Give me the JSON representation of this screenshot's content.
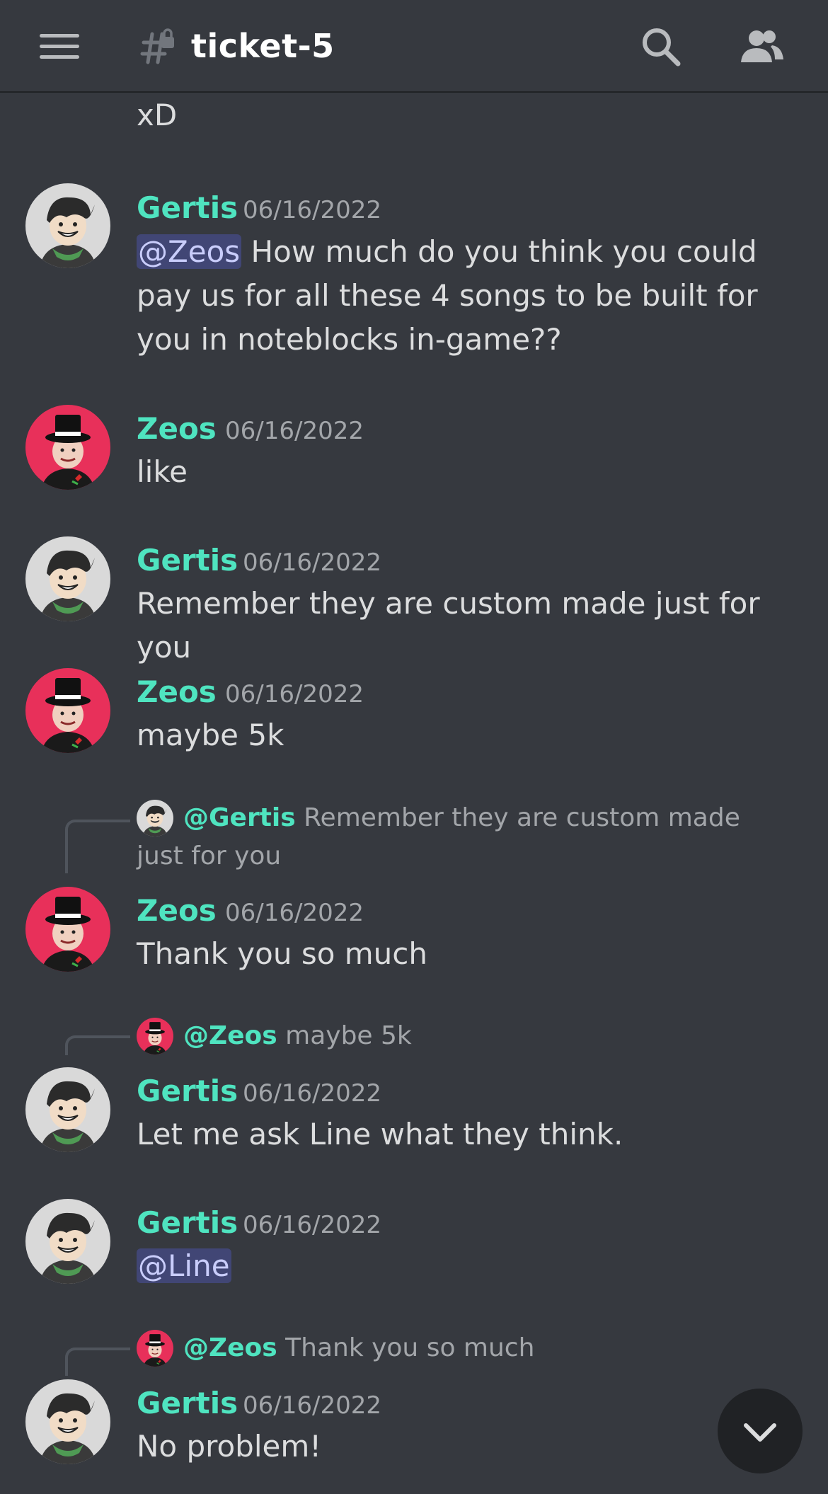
{
  "header": {
    "channel_name": "ticket-5",
    "menu_icon": "hamburger-icon",
    "channel_icon": "locked-hash-icon",
    "search_icon": "search-icon",
    "members_icon": "members-icon"
  },
  "colors": {
    "background": "#36393f",
    "username": "#4fe4c0",
    "mention_bg": "#414675",
    "mention_text": "#c9cdfb",
    "timestamp": "#a3a6aa",
    "gertis_avatar_bg": "#d9d9d9",
    "zeos_avatar_bg": "#e8305a"
  },
  "messages": {
    "m0": {
      "text": "xD"
    },
    "m1": {
      "author": "Gertis",
      "time": "06/16/2022",
      "mention": "@Zeos",
      "text": " How much do you think you could pay us for all these 4 songs to be built for you in noteblocks in-game??"
    },
    "m2": {
      "author": "Zeos",
      "time": "06/16/2022",
      "text": "like"
    },
    "m3": {
      "author": "Gertis",
      "time": "06/16/2022",
      "text": "Remember they are custom made just for you"
    },
    "m4": {
      "author": "Zeos",
      "time": "06/16/2022",
      "text": "maybe 5k"
    },
    "m5": {
      "reply_name": "@Gertis",
      "reply_text": " Remember they are custom made just for you",
      "author": "Zeos",
      "time": "06/16/2022",
      "text": "Thank you so much"
    },
    "m6": {
      "reply_name": "@Zeos",
      "reply_text": " maybe 5k",
      "author": "Gertis",
      "time": "06/16/2022",
      "text": "Let me ask Line what they think."
    },
    "m7": {
      "author": "Gertis",
      "time": "06/16/2022",
      "mention": "@Line"
    },
    "m8": {
      "reply_name": "@Zeos",
      "reply_text": " Thank you so much",
      "author": "Gertis",
      "time": "06/16/2022",
      "text": "No problem!"
    }
  },
  "scroll_button": {
    "icon": "chevron-down-icon"
  }
}
